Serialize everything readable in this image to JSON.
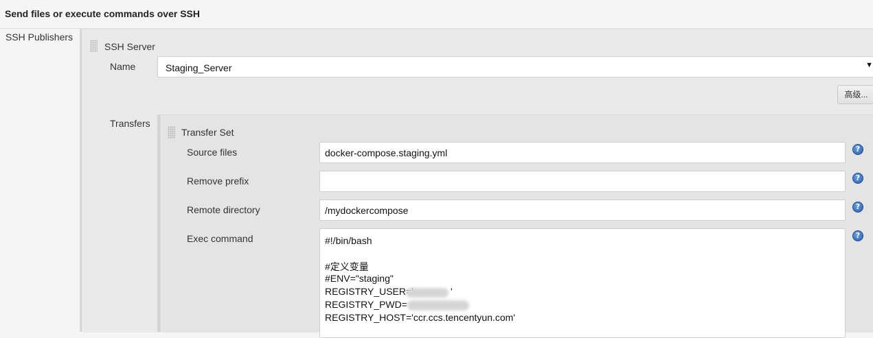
{
  "header": {
    "title": "Send files or execute commands over SSH"
  },
  "section": {
    "label": "SSH Publishers"
  },
  "ssh_server": {
    "heading": "SSH Server",
    "name_label": "Name",
    "name_value": "Staging_Server",
    "advanced_button": "高级..."
  },
  "transfers": {
    "label": "Transfers",
    "heading": "Transfer Set",
    "source_files_label": "Source files",
    "source_files_value": "docker-compose.staging.yml",
    "remove_prefix_label": "Remove prefix",
    "remove_prefix_value": "",
    "remote_directory_label": "Remote directory",
    "remote_directory_value": "/mydockercompose",
    "exec_command_label": "Exec command",
    "exec_command_lines": [
      "#!/bin/bash",
      "",
      "#定义变量",
      "#ENV=\"staging\"",
      "REGISTRY_USER='",
      "REGISTRY_PWD=",
      "REGISTRY_HOST='ccr.ccs.tencentyun.com'"
    ],
    "registry_user_suffix": "'"
  },
  "icons": {
    "help": "help-icon",
    "select_arrow": "dropdown-arrow-icon",
    "drag_handle": "drag-handle-icon"
  },
  "colors": {
    "help_blue": "#2c5fa8",
    "panel_bg": "#eaeaea"
  }
}
